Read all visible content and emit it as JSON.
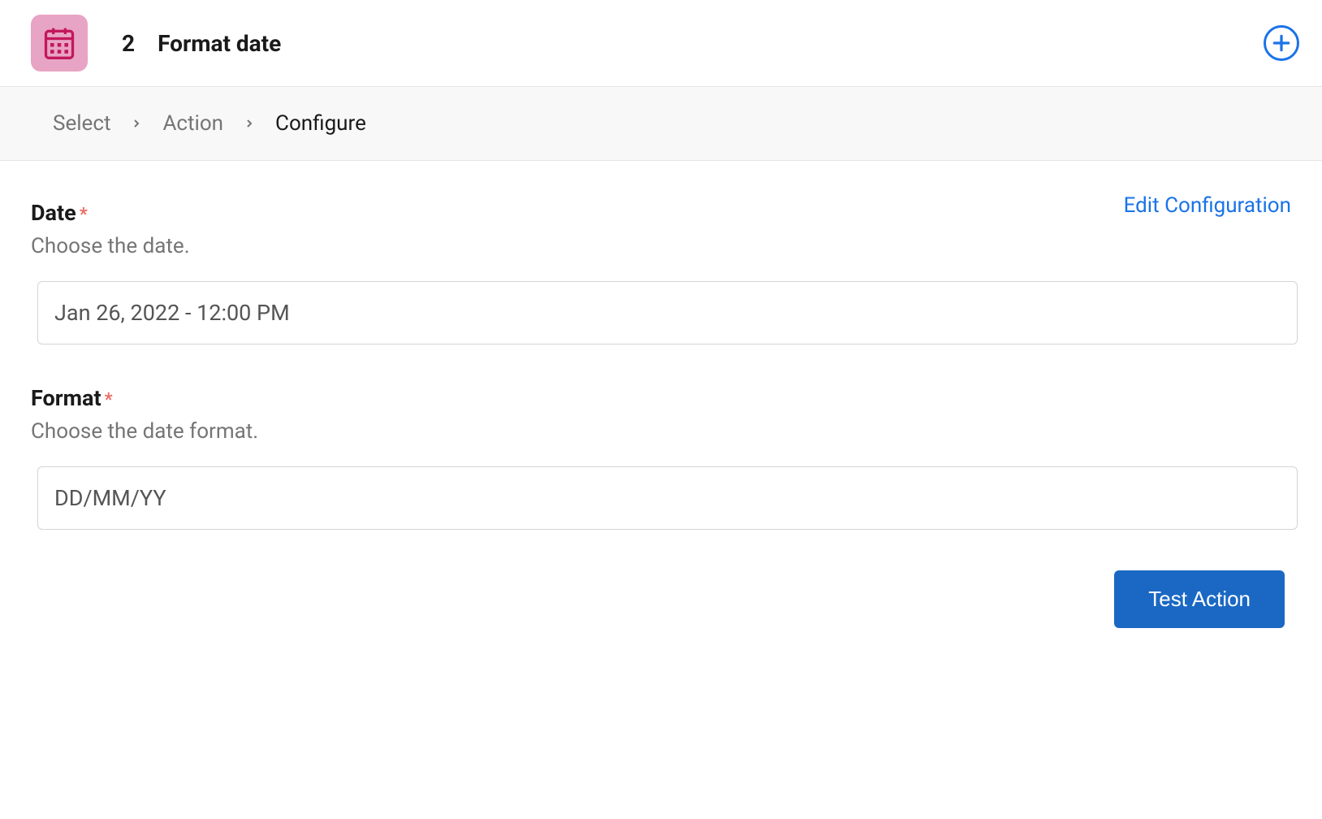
{
  "header": {
    "step_number": "2",
    "step_title": "Format date",
    "icon_name": "calendar-icon"
  },
  "breadcrumb": {
    "items": [
      {
        "label": "Select",
        "active": false
      },
      {
        "label": "Action",
        "active": false
      },
      {
        "label": "Configure",
        "active": true
      }
    ]
  },
  "edit_config_label": "Edit Configuration",
  "fields": {
    "date": {
      "label": "Date",
      "required_mark": "*",
      "description": "Choose the date.",
      "value": "Jan 26, 2022 - 12:00 PM"
    },
    "format": {
      "label": "Format",
      "required_mark": "*",
      "description": "Choose the date format.",
      "value": "DD/MM/YY"
    }
  },
  "buttons": {
    "test_action": "Test Action"
  }
}
